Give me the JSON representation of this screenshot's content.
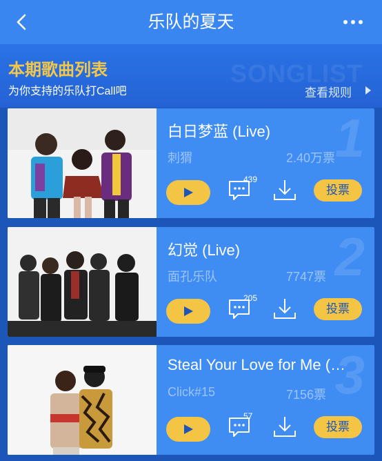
{
  "header": {
    "title": "乐队的夏天",
    "back_icon": "chevron-left-icon",
    "more_icon": "more-dots-icon"
  },
  "banner": {
    "title": "本期歌曲列表",
    "subtitle": "为你支持的乐队打Call吧",
    "watermark": "SONGLIST",
    "rules_link": "查看规则"
  },
  "songs": [
    {
      "rank": "1",
      "name": "白日梦蓝 (Live)",
      "artist": "刺猬",
      "votes": "2.40万票",
      "comments": "439",
      "vote_label": "投票"
    },
    {
      "rank": "2",
      "name": "幻觉 (Live)",
      "artist": "面孔乐队",
      "votes": "7747票",
      "comments": "205",
      "vote_label": "投票"
    },
    {
      "rank": "3",
      "name": "Steal Your Love for Me (…",
      "artist": "Click#15",
      "votes": "7156票",
      "comments": "57",
      "vote_label": "投票"
    }
  ],
  "colors": {
    "header_bg": "#3a86f0",
    "page_bg": "#1c56b8",
    "card_bg": "#3f8cf3",
    "accent_yellow": "#f4c445",
    "title_yellow": "#f3c74a",
    "muted_text": "#9cc5ff"
  }
}
